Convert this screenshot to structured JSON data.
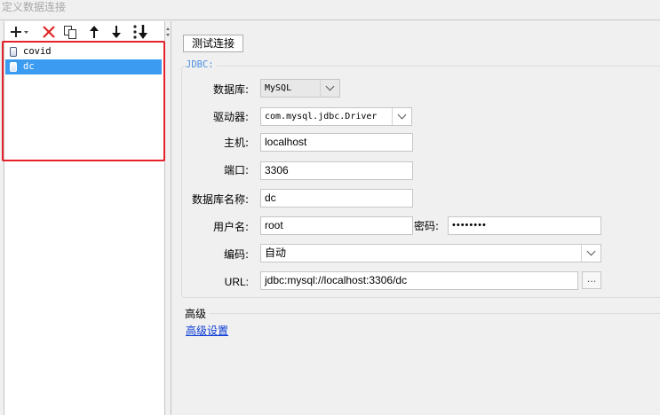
{
  "window": {
    "title": "定义数据连接"
  },
  "toolbar": {
    "add_icon": "plus-icon",
    "delete_icon": "red-x-icon",
    "copy_icon": "copy-icon",
    "up_icon": "arrow-up-icon",
    "down_icon": "arrow-down-icon",
    "sort_icon": "sort-icon"
  },
  "connections": [
    {
      "name": "covid",
      "selected": false
    },
    {
      "name": "dc",
      "selected": true
    }
  ],
  "form": {
    "test_button": "测试连接",
    "jdbc_legend": "JDBC:",
    "database_label": "数据库:",
    "database_value": "MySQL",
    "driver_label": "驱动器:",
    "driver_value": "com.mysql.jdbc.Driver",
    "host_label": "主机:",
    "host_value": "localhost",
    "port_label": "端口:",
    "port_value": "3306",
    "dbname_label": "数据库名称:",
    "dbname_value": "dc",
    "user_label": "用户名:",
    "user_value": "root",
    "password_label": "密码:",
    "password_value": "••••••••",
    "encoding_label": "编码:",
    "encoding_value": "自动",
    "url_label": "URL:",
    "url_value": "jdbc:mysql://localhost:3306/dc",
    "url_button": "..."
  },
  "advanced": {
    "title": "高级",
    "link": "高级设置"
  },
  "colors": {
    "selection": "#3a9bf0",
    "highlight_box": "#e5212b",
    "link": "#0a3bd6",
    "legend": "#4a8fe0"
  }
}
